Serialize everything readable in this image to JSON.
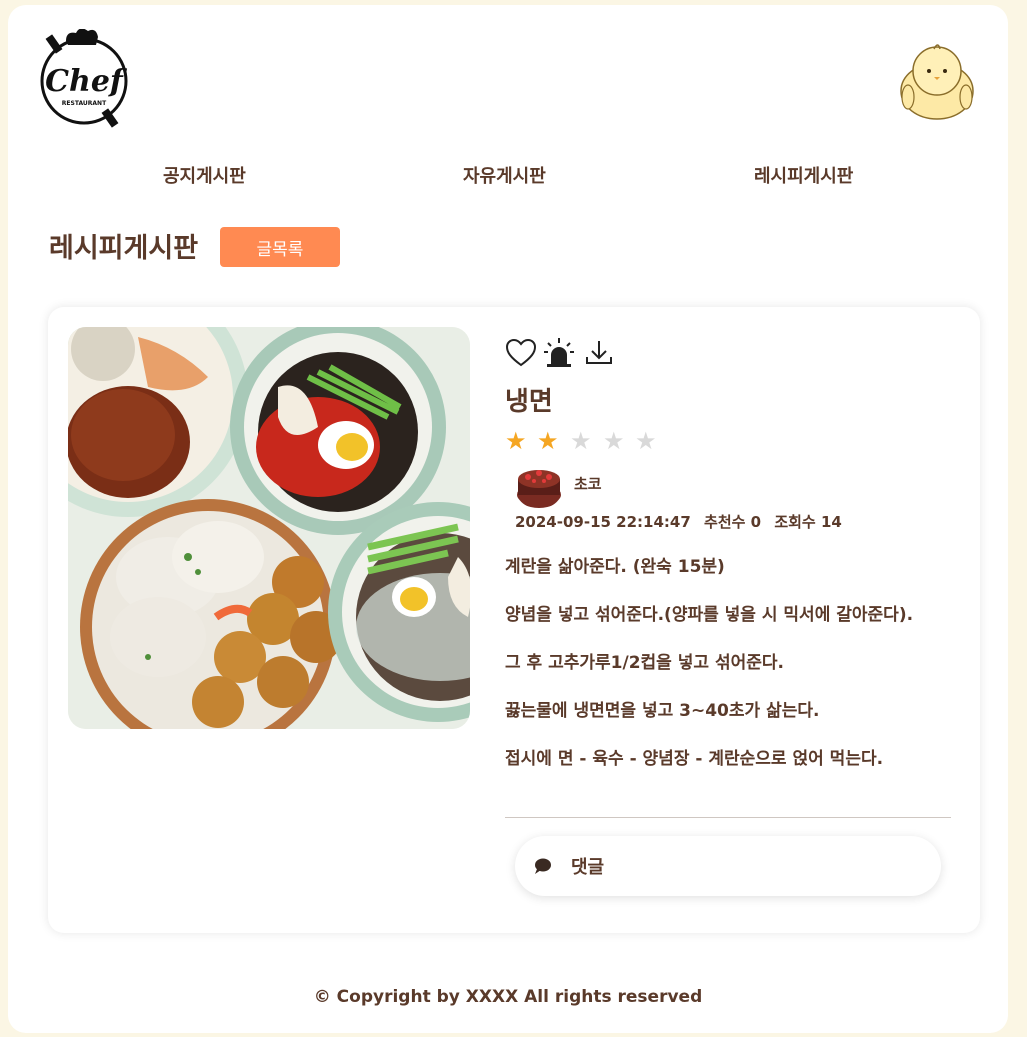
{
  "logo": {
    "text": "Chef",
    "subtext": "RESTAURANT",
    "icon": "chef-logo"
  },
  "user_avatar_icon": "yellow-chick-avatar",
  "nav": {
    "items": [
      {
        "label": "공지게시판"
      },
      {
        "label": "자유게시판"
      },
      {
        "label": "레시피게시판"
      }
    ]
  },
  "board": {
    "title": "레시피게시판",
    "list_button": "글목록"
  },
  "post": {
    "actions": [
      "heart-icon",
      "siren-icon",
      "download-icon"
    ],
    "title": "냉면",
    "rating": 2,
    "rating_max": 5,
    "author": {
      "name": "초코",
      "avatar": "cake-avatar"
    },
    "datetime": "2024-09-15 22:14:47",
    "recommend": "추천수 0",
    "views": "조회수 14",
    "steps": [
      "계란을 삶아준다. (완숙 15분)",
      "양념을 넣고 섞어준다.(양파를 넣을 시 믹서에 갈아준다).",
      "그 후 고추가루1/2컵을 넣고 섞어준다.",
      "끓는물에 냉면면을 넣고 3~40초가 삶는다.",
      "접시에 면 - 육수 - 양념장 - 계란순으로 얹어 먹는다."
    ],
    "comment_label": "댓글"
  },
  "footer": "© Copyright by XXXX All rights reserved",
  "colors": {
    "accent": "#ff8a52",
    "text": "#5a3a2a",
    "background": "#fbf6e4",
    "star_on": "#f5a623",
    "star_off": "#d9d9d9"
  }
}
